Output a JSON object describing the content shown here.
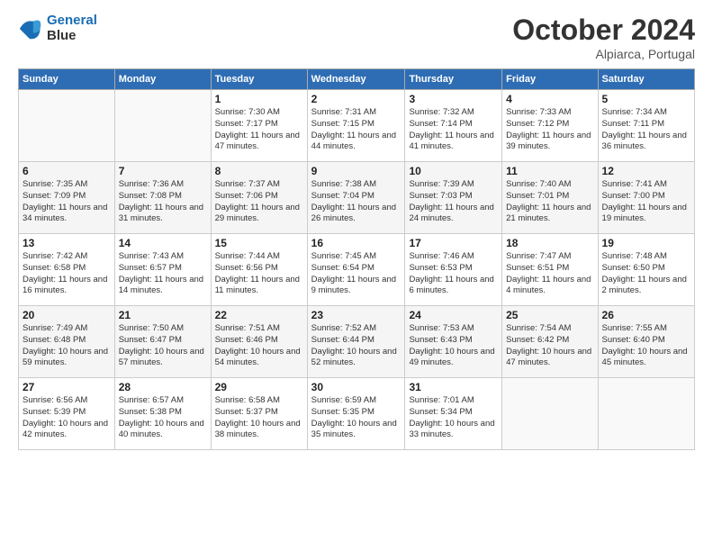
{
  "header": {
    "logo_line1": "General",
    "logo_line2": "Blue",
    "month": "October 2024",
    "location": "Alpiarca, Portugal"
  },
  "weekdays": [
    "Sunday",
    "Monday",
    "Tuesday",
    "Wednesday",
    "Thursday",
    "Friday",
    "Saturday"
  ],
  "weeks": [
    [
      {
        "day": "",
        "sunrise": "",
        "sunset": "",
        "daylight": ""
      },
      {
        "day": "",
        "sunrise": "",
        "sunset": "",
        "daylight": ""
      },
      {
        "day": "1",
        "sunrise": "Sunrise: 7:30 AM",
        "sunset": "Sunset: 7:17 PM",
        "daylight": "Daylight: 11 hours and 47 minutes."
      },
      {
        "day": "2",
        "sunrise": "Sunrise: 7:31 AM",
        "sunset": "Sunset: 7:15 PM",
        "daylight": "Daylight: 11 hours and 44 minutes."
      },
      {
        "day": "3",
        "sunrise": "Sunrise: 7:32 AM",
        "sunset": "Sunset: 7:14 PM",
        "daylight": "Daylight: 11 hours and 41 minutes."
      },
      {
        "day": "4",
        "sunrise": "Sunrise: 7:33 AM",
        "sunset": "Sunset: 7:12 PM",
        "daylight": "Daylight: 11 hours and 39 minutes."
      },
      {
        "day": "5",
        "sunrise": "Sunrise: 7:34 AM",
        "sunset": "Sunset: 7:11 PM",
        "daylight": "Daylight: 11 hours and 36 minutes."
      }
    ],
    [
      {
        "day": "6",
        "sunrise": "Sunrise: 7:35 AM",
        "sunset": "Sunset: 7:09 PM",
        "daylight": "Daylight: 11 hours and 34 minutes."
      },
      {
        "day": "7",
        "sunrise": "Sunrise: 7:36 AM",
        "sunset": "Sunset: 7:08 PM",
        "daylight": "Daylight: 11 hours and 31 minutes."
      },
      {
        "day": "8",
        "sunrise": "Sunrise: 7:37 AM",
        "sunset": "Sunset: 7:06 PM",
        "daylight": "Daylight: 11 hours and 29 minutes."
      },
      {
        "day": "9",
        "sunrise": "Sunrise: 7:38 AM",
        "sunset": "Sunset: 7:04 PM",
        "daylight": "Daylight: 11 hours and 26 minutes."
      },
      {
        "day": "10",
        "sunrise": "Sunrise: 7:39 AM",
        "sunset": "Sunset: 7:03 PM",
        "daylight": "Daylight: 11 hours and 24 minutes."
      },
      {
        "day": "11",
        "sunrise": "Sunrise: 7:40 AM",
        "sunset": "Sunset: 7:01 PM",
        "daylight": "Daylight: 11 hours and 21 minutes."
      },
      {
        "day": "12",
        "sunrise": "Sunrise: 7:41 AM",
        "sunset": "Sunset: 7:00 PM",
        "daylight": "Daylight: 11 hours and 19 minutes."
      }
    ],
    [
      {
        "day": "13",
        "sunrise": "Sunrise: 7:42 AM",
        "sunset": "Sunset: 6:58 PM",
        "daylight": "Daylight: 11 hours and 16 minutes."
      },
      {
        "day": "14",
        "sunrise": "Sunrise: 7:43 AM",
        "sunset": "Sunset: 6:57 PM",
        "daylight": "Daylight: 11 hours and 14 minutes."
      },
      {
        "day": "15",
        "sunrise": "Sunrise: 7:44 AM",
        "sunset": "Sunset: 6:56 PM",
        "daylight": "Daylight: 11 hours and 11 minutes."
      },
      {
        "day": "16",
        "sunrise": "Sunrise: 7:45 AM",
        "sunset": "Sunset: 6:54 PM",
        "daylight": "Daylight: 11 hours and 9 minutes."
      },
      {
        "day": "17",
        "sunrise": "Sunrise: 7:46 AM",
        "sunset": "Sunset: 6:53 PM",
        "daylight": "Daylight: 11 hours and 6 minutes."
      },
      {
        "day": "18",
        "sunrise": "Sunrise: 7:47 AM",
        "sunset": "Sunset: 6:51 PM",
        "daylight": "Daylight: 11 hours and 4 minutes."
      },
      {
        "day": "19",
        "sunrise": "Sunrise: 7:48 AM",
        "sunset": "Sunset: 6:50 PM",
        "daylight": "Daylight: 11 hours and 2 minutes."
      }
    ],
    [
      {
        "day": "20",
        "sunrise": "Sunrise: 7:49 AM",
        "sunset": "Sunset: 6:48 PM",
        "daylight": "Daylight: 10 hours and 59 minutes."
      },
      {
        "day": "21",
        "sunrise": "Sunrise: 7:50 AM",
        "sunset": "Sunset: 6:47 PM",
        "daylight": "Daylight: 10 hours and 57 minutes."
      },
      {
        "day": "22",
        "sunrise": "Sunrise: 7:51 AM",
        "sunset": "Sunset: 6:46 PM",
        "daylight": "Daylight: 10 hours and 54 minutes."
      },
      {
        "day": "23",
        "sunrise": "Sunrise: 7:52 AM",
        "sunset": "Sunset: 6:44 PM",
        "daylight": "Daylight: 10 hours and 52 minutes."
      },
      {
        "day": "24",
        "sunrise": "Sunrise: 7:53 AM",
        "sunset": "Sunset: 6:43 PM",
        "daylight": "Daylight: 10 hours and 49 minutes."
      },
      {
        "day": "25",
        "sunrise": "Sunrise: 7:54 AM",
        "sunset": "Sunset: 6:42 PM",
        "daylight": "Daylight: 10 hours and 47 minutes."
      },
      {
        "day": "26",
        "sunrise": "Sunrise: 7:55 AM",
        "sunset": "Sunset: 6:40 PM",
        "daylight": "Daylight: 10 hours and 45 minutes."
      }
    ],
    [
      {
        "day": "27",
        "sunrise": "Sunrise: 6:56 AM",
        "sunset": "Sunset: 5:39 PM",
        "daylight": "Daylight: 10 hours and 42 minutes."
      },
      {
        "day": "28",
        "sunrise": "Sunrise: 6:57 AM",
        "sunset": "Sunset: 5:38 PM",
        "daylight": "Daylight: 10 hours and 40 minutes."
      },
      {
        "day": "29",
        "sunrise": "Sunrise: 6:58 AM",
        "sunset": "Sunset: 5:37 PM",
        "daylight": "Daylight: 10 hours and 38 minutes."
      },
      {
        "day": "30",
        "sunrise": "Sunrise: 6:59 AM",
        "sunset": "Sunset: 5:35 PM",
        "daylight": "Daylight: 10 hours and 35 minutes."
      },
      {
        "day": "31",
        "sunrise": "Sunrise: 7:01 AM",
        "sunset": "Sunset: 5:34 PM",
        "daylight": "Daylight: 10 hours and 33 minutes."
      },
      {
        "day": "",
        "sunrise": "",
        "sunset": "",
        "daylight": ""
      },
      {
        "day": "",
        "sunrise": "",
        "sunset": "",
        "daylight": ""
      }
    ]
  ]
}
